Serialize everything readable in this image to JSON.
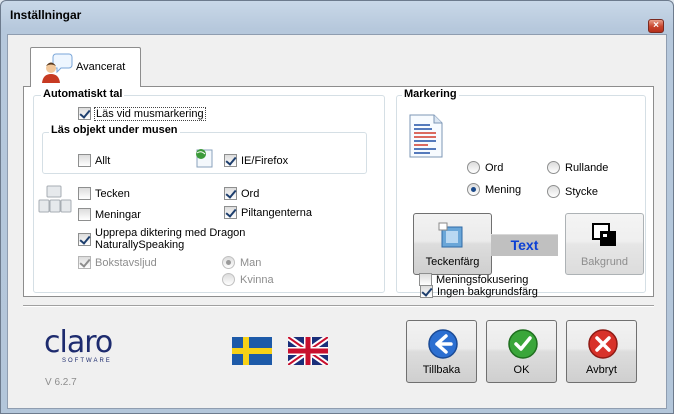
{
  "window": {
    "title": "Inställningar",
    "close_glyph": "×"
  },
  "tabs": [
    {
      "label": "Avancerat",
      "icon": "speaker-person-icon"
    }
  ],
  "auto_speech": {
    "title": "Automatiskt tal",
    "read_on_select": {
      "label": "Läs vid musmarkering",
      "checked": true
    },
    "objects_group": {
      "title": "Läs objekt under musen",
      "all": {
        "label": "Allt",
        "checked": false
      },
      "ie_firefox": {
        "label": "IE/Firefox",
        "checked": true
      }
    },
    "chars": {
      "label": "Tecken",
      "checked": false
    },
    "sentences": {
      "label": "Meningar",
      "checked": false
    },
    "words": {
      "label": "Ord",
      "checked": true
    },
    "arrow_keys": {
      "label": "Piltangenterna",
      "checked": true
    },
    "dragon": {
      "label_line1": "Upprepa diktering med Dragon",
      "label_line2": "NaturallySpeaking",
      "checked": true
    },
    "phonics": {
      "label": "Bokstavsljud",
      "checked": true,
      "disabled": true
    },
    "voice_man": {
      "label": "Man",
      "selected": true,
      "disabled": true
    },
    "voice_woman": {
      "label": "Kvinna",
      "selected": false,
      "disabled": true
    }
  },
  "marking": {
    "title": "Markering",
    "word": {
      "label": "Ord",
      "selected": false
    },
    "rolling": {
      "label": "Rullande",
      "selected": false
    },
    "sentence": {
      "label": "Mening",
      "selected": true
    },
    "paragraph": {
      "label": "Stycke",
      "selected": false
    },
    "text_color_button": "Teckenfärg",
    "preview_text": "Text",
    "background_button": "Bakgrund",
    "no_background": {
      "label": "Ingen bakgrundsfärg",
      "checked": true
    },
    "sentence_focus": {
      "label": "Meningsfokusering",
      "checked": false
    },
    "colors": {
      "preview_text": "#0b3fd4",
      "preview_bg": "#c0c0c0"
    }
  },
  "footer": {
    "logo_word": "claro",
    "logo_sub": "SOFTWARE",
    "version": "V 6.2.7",
    "flags": [
      "swedish-flag",
      "uk-flag"
    ],
    "back_button": "Tillbaka",
    "ok_button": "OK",
    "cancel_button": "Avbryt"
  }
}
